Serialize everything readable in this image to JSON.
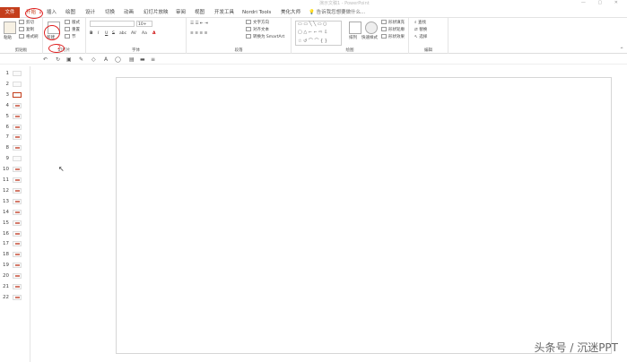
{
  "titlebar": {
    "title": "演示文稿1 - PowerPoint"
  },
  "tabs": [
    "文件",
    "开始",
    "插入",
    "绘图",
    "设计",
    "切换",
    "动画",
    "幻灯片放映",
    "审阅",
    "视图",
    "开发工具",
    "Nordri Tools",
    "美化大师"
  ],
  "search": {
    "placeholder": "告诉我您想要做什么..."
  },
  "ribbon": {
    "clipboard": {
      "paste": "粘贴",
      "cut": "剪切",
      "copy": "复制",
      "format_painter": "格式刷",
      "label": "剪贴板"
    },
    "slides": {
      "new_slide": "新建",
      "layout": "版式",
      "reset": "重置",
      "section": "节",
      "label": "幻灯片"
    },
    "font": {
      "font_size": "10+",
      "label": "字体",
      "bold": "B",
      "italic": "I",
      "underline": "U",
      "strike": "S",
      "shadow": "abc",
      "spacing": "AV",
      "case": "Aa",
      "color": "A"
    },
    "paragraph": {
      "text_dir": "文字方向",
      "align_text": "对齐文本",
      "smartart": "转换为 SmartArt",
      "label": "段落"
    },
    "drawing": {
      "arrange": "排列",
      "quick_styles": "快速样式",
      "fill": "形状填充",
      "outline": "形状轮廓",
      "effects": "形状效果",
      "label": "绘图"
    },
    "editing": {
      "find": "查找",
      "replace": "替换",
      "select": "选择",
      "label": "编辑"
    }
  },
  "annotations": {
    "mark1": "1",
    "mark2": "2"
  },
  "slides": [
    "1",
    "2",
    "3",
    "4",
    "5",
    "6",
    "7",
    "8",
    "9",
    "10",
    "11",
    "12",
    "13",
    "14",
    "15",
    "16",
    "17",
    "18",
    "19",
    "20",
    "21",
    "22"
  ],
  "selected_slide": "3",
  "watermark": "头条号 / 沉迷PPT"
}
